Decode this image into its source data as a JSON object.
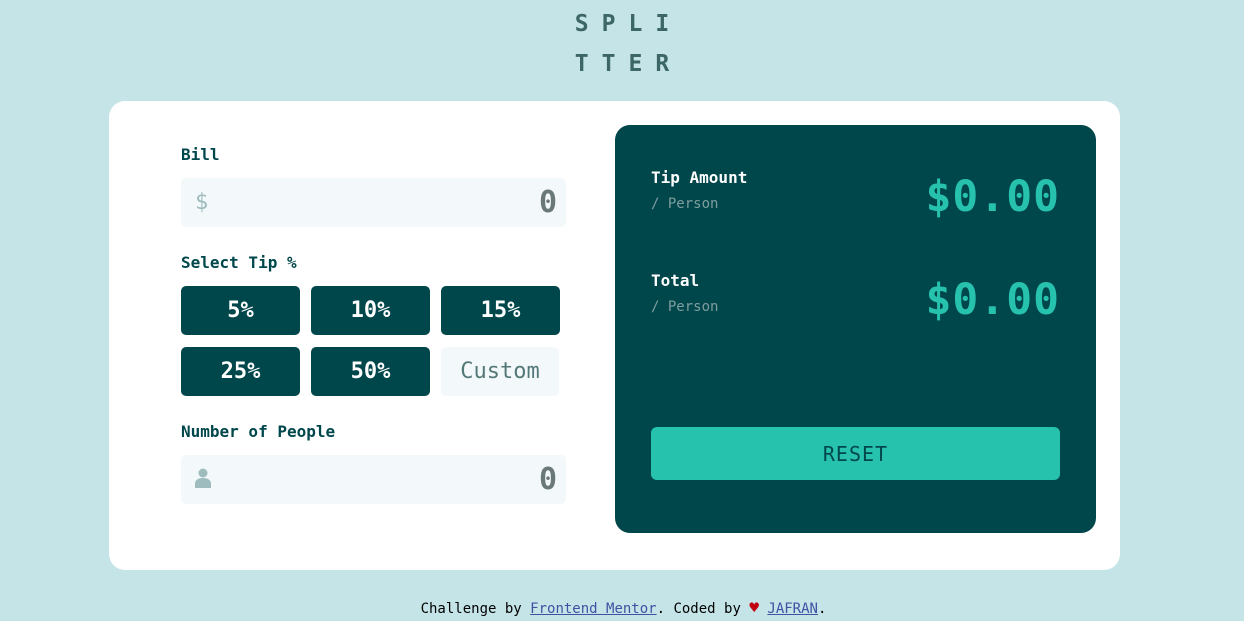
{
  "logo": {
    "line1": "SPLI",
    "line2": "TTER"
  },
  "bill": {
    "label": "Bill",
    "prefix": "$",
    "value": "0"
  },
  "tip": {
    "label": "Select Tip %",
    "options": [
      "5%",
      "10%",
      "15%",
      "25%",
      "50%"
    ],
    "custom_placeholder": "Custom"
  },
  "people": {
    "label": "Number of People",
    "value": "0"
  },
  "results": {
    "tip_amount_label": "Tip Amount",
    "tip_amount_sub": "/ Person",
    "tip_amount_value": "$0.00",
    "total_label": "Total",
    "total_sub": "/ Person",
    "total_value": "$0.00",
    "reset_label": "RESET"
  },
  "footer": {
    "prefix": "Challenge by ",
    "link1": "Frontend Mentor",
    "middle": ". Coded by ",
    "heart": "♥",
    "link2": "JAFRAN",
    "suffix": "."
  },
  "colors": {
    "background": "#c5e4e7",
    "dark_cyan": "#00474b",
    "strong_cyan": "#26c2ae",
    "input_bg": "#f3f9fa"
  }
}
